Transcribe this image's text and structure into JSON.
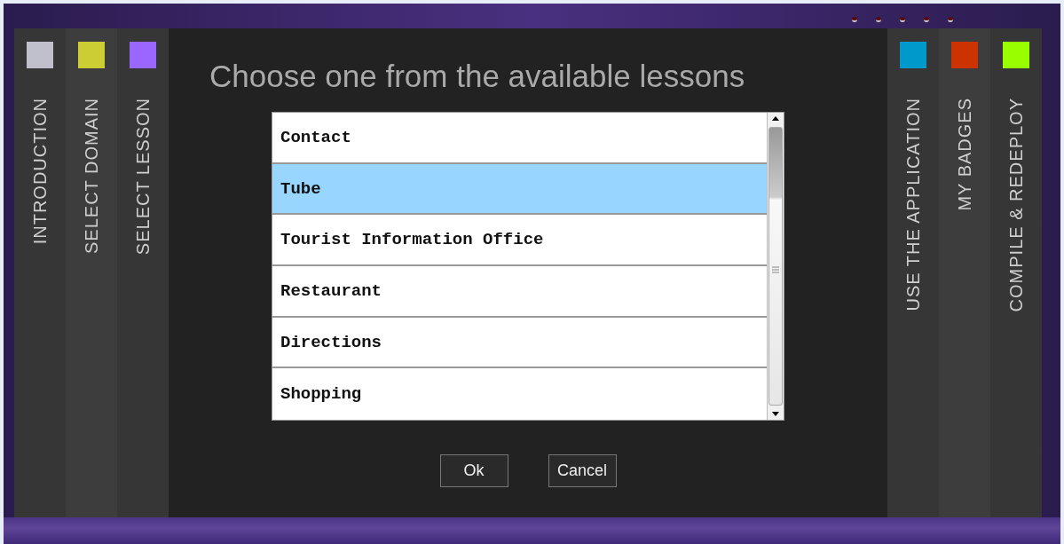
{
  "left_tabs": [
    {
      "label": "INTRODUCTION",
      "color": "#c0c0cc"
    },
    {
      "label": "SELECT DOMAIN",
      "color": "#cccc33"
    },
    {
      "label": "SELECT LESSON",
      "color": "#9966ff"
    }
  ],
  "right_tabs": [
    {
      "label": "USE THE APPLICATION",
      "color": "#0099cc"
    },
    {
      "label": "MY BADGES",
      "color": "#cc3300"
    },
    {
      "label": "COMPILE & REDEPLOY",
      "color": "#99ff00"
    }
  ],
  "dialog": {
    "title": "Choose one from the available lessons",
    "lessons": [
      {
        "label": "Contact",
        "selected": false
      },
      {
        "label": "Tube",
        "selected": true
      },
      {
        "label": "Tourist Information Office",
        "selected": false
      },
      {
        "label": "Restaurant",
        "selected": false
      },
      {
        "label": "Directions",
        "selected": false
      },
      {
        "label": "Shopping",
        "selected": false
      }
    ],
    "buttons": [
      "Ok",
      "Cancel"
    ]
  }
}
